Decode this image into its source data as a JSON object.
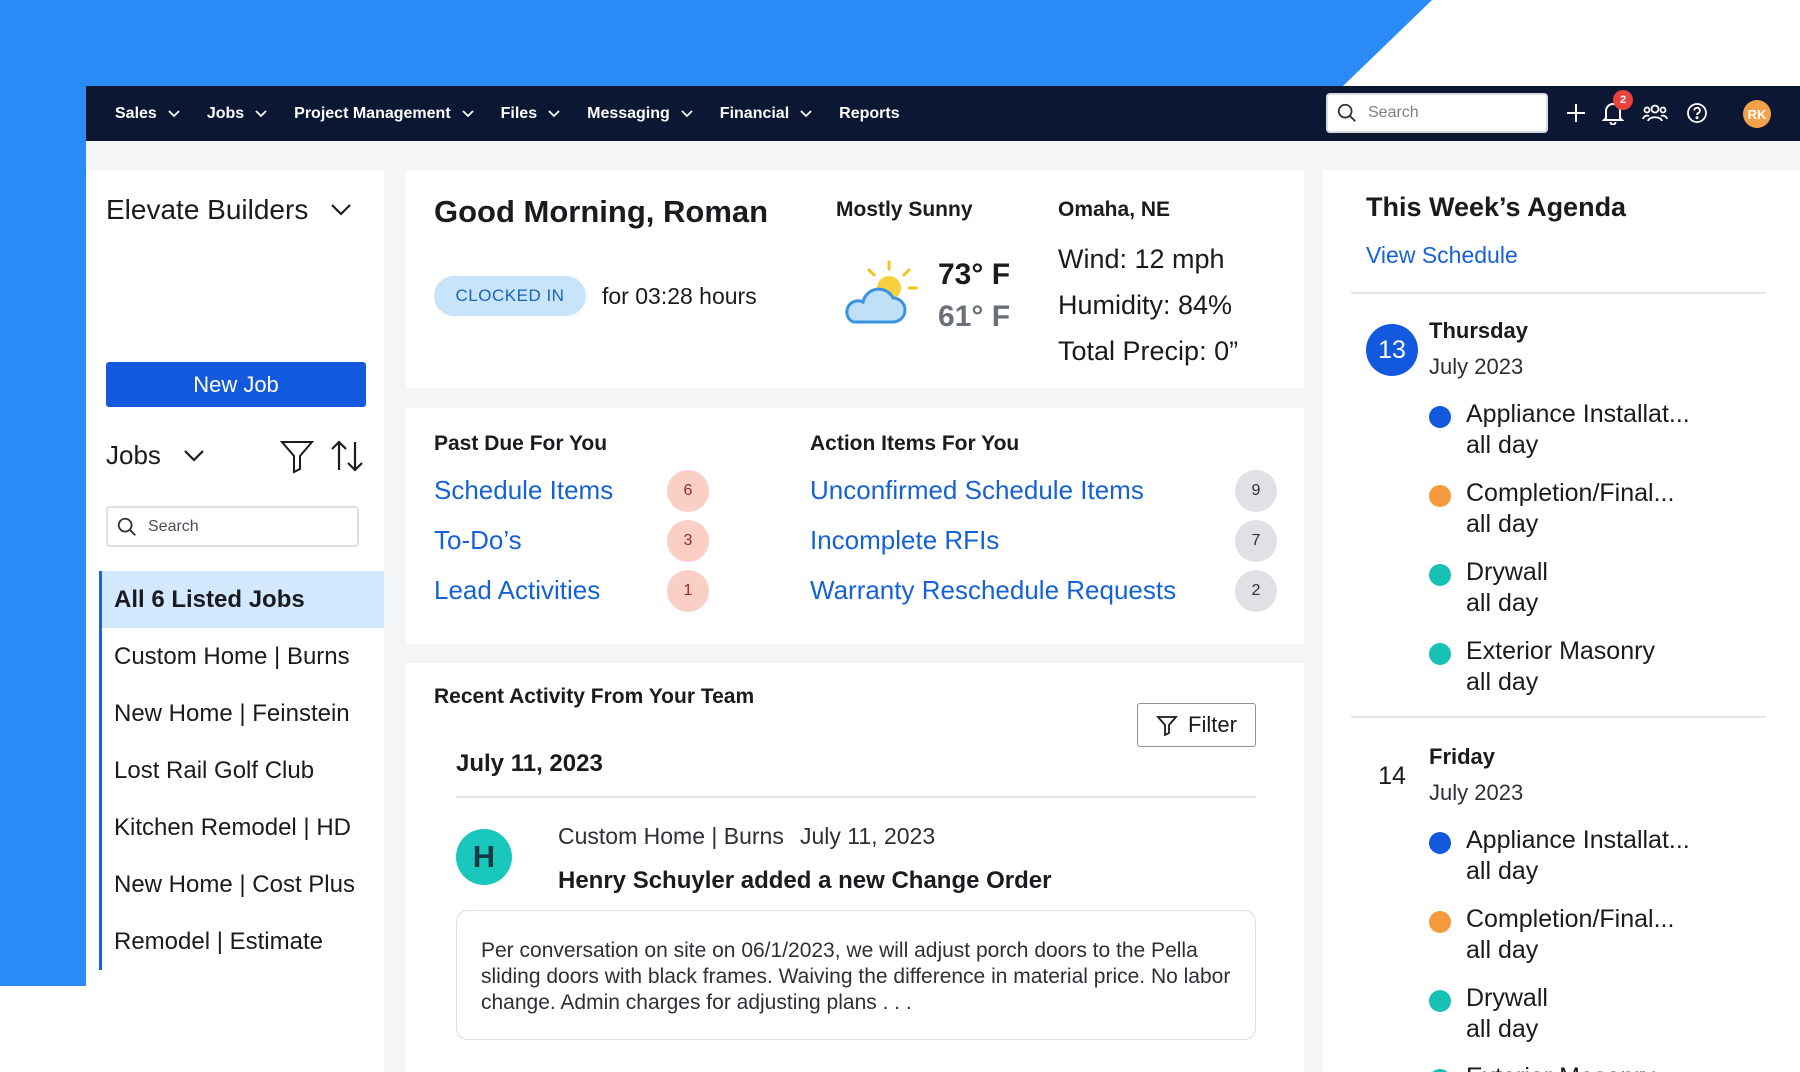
{
  "nav": {
    "items": [
      {
        "label": "Sales",
        "dropdown": true
      },
      {
        "label": "Jobs",
        "dropdown": true
      },
      {
        "label": "Project Management",
        "dropdown": true
      },
      {
        "label": "Files",
        "dropdown": true
      },
      {
        "label": "Messaging",
        "dropdown": true
      },
      {
        "label": "Financial",
        "dropdown": true
      },
      {
        "label": "Reports",
        "dropdown": false
      }
    ],
    "search_placeholder": "Search",
    "notification_count": "2",
    "user_initials": "RK"
  },
  "sidebar": {
    "org_name": "Elevate Builders",
    "new_job_label": "New Job",
    "jobs_label": "Jobs",
    "search_placeholder": "Search",
    "jobs": [
      {
        "label": "All 6 Listed Jobs",
        "selected": true
      },
      {
        "label": "Custom Home | Burns",
        "selected": false
      },
      {
        "label": "New Home | Feinstein",
        "selected": false
      },
      {
        "label": "Lost Rail Golf Club",
        "selected": false
      },
      {
        "label": "Kitchen Remodel | HD",
        "selected": false
      },
      {
        "label": "New Home | Cost Plus",
        "selected": false
      },
      {
        "label": "Remodel | Estimate",
        "selected": false
      }
    ]
  },
  "greeting": {
    "title": "Good Morning, Roman",
    "status_pill": "CLOCKED IN",
    "duration": "for 03:28 hours",
    "condition": "Mostly Sunny",
    "temp_high": "73° F",
    "temp_low": "61° F",
    "location": "Omaha, NE",
    "wind": "Wind: 12 mph",
    "humidity": "Humidity: 84%",
    "precip": "Total Precip: 0”"
  },
  "past_due": {
    "title": "Past Due For You",
    "items": [
      {
        "label": "Schedule Items",
        "count": "6"
      },
      {
        "label": "To-Do’s",
        "count": "3"
      },
      {
        "label": "Lead Activities",
        "count": "1"
      }
    ]
  },
  "action_items": {
    "title": "Action Items For You",
    "items": [
      {
        "label": "Unconfirmed Schedule Items",
        "count": "9"
      },
      {
        "label": "Incomplete RFIs",
        "count": "7"
      },
      {
        "label": "Warranty Reschedule Requests",
        "count": "2"
      }
    ]
  },
  "activity": {
    "title": "Recent Activity From Your Team",
    "filter_label": "Filter",
    "date_header": "July 11, 2023",
    "entry": {
      "avatar_initial": "H",
      "job": "Custom Home | Burns",
      "date": "July 11, 2023",
      "headline": "Henry Schuyler added a new Change Order",
      "body": "Per conversation on site on 06/1/2023, we will adjust porch doors to the Pella sliding doors with black frames. Waiving the difference in material price. No labor change. Admin charges for adjusting plans . . ."
    }
  },
  "agenda": {
    "title": "This Week’s Agenda",
    "link": "View Schedule",
    "days": [
      {
        "day_number": "13",
        "highlighted": true,
        "day_name": "Thursday",
        "month": "July 2023",
        "events": [
          {
            "name": "Appliance Installat...",
            "time": "all day",
            "color": "#1359de"
          },
          {
            "name": "Completion/Final...",
            "time": "all day",
            "color": "#f59a3c"
          },
          {
            "name": "Drywall",
            "time": "all day",
            "color": "#17c1b6"
          },
          {
            "name": "Exterior Masonry",
            "time": "all day",
            "color": "#17c1b6"
          }
        ]
      },
      {
        "day_number": "14",
        "highlighted": false,
        "day_name": "Friday",
        "month": "July 2023",
        "events": [
          {
            "name": "Appliance Installat...",
            "time": "all day",
            "color": "#1359de"
          },
          {
            "name": "Completion/Final...",
            "time": "all day",
            "color": "#f59a3c"
          },
          {
            "name": "Drywall",
            "time": "all day",
            "color": "#17c1b6"
          },
          {
            "name": "Exterior Masonry",
            "time": "",
            "color": "#17c1b6"
          }
        ]
      }
    ]
  },
  "colors": {
    "brand_blue": "#1359de",
    "backdrop_blue": "#2a8bf7",
    "nav_dark": "#0c1733",
    "link_blue": "#1562d6"
  }
}
